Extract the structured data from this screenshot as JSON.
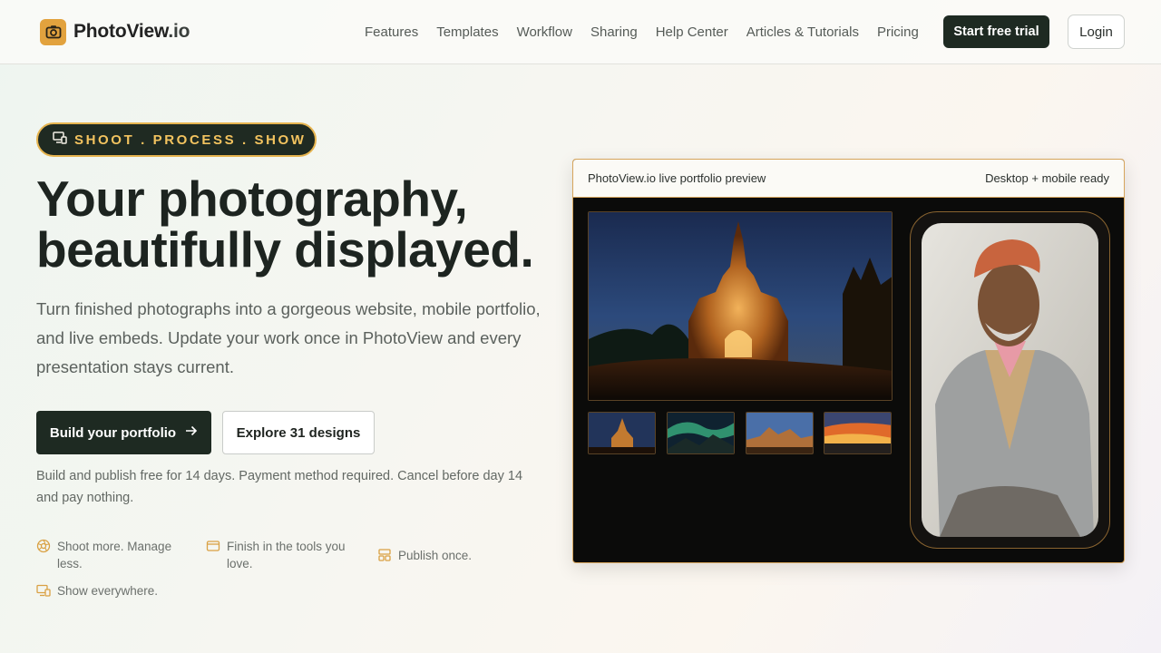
{
  "brand": {
    "name": "PhotoView",
    "tld": ".io",
    "accent": "#e2a23e",
    "dark": "#1e2a22"
  },
  "nav": {
    "links": [
      "Features",
      "Templates",
      "Workflow",
      "Sharing",
      "Help Center",
      "Articles & Tutorials",
      "Pricing"
    ],
    "trial_label": "Start free trial",
    "login_label": "Login"
  },
  "hero": {
    "badge": "SHOOT . PROCESS . SHOW",
    "headline_line1": "Your photography,",
    "headline_line2": "beautifully displayed.",
    "subtitle": "Turn finished photographs into a gorgeous website, mobile portfolio, and live embeds. Update your work once in PhotoView and every presentation stays current.",
    "primary_cta": "Build your portfolio",
    "secondary_cta": "Explore 31 designs",
    "note": "Build and publish free for 14 days. Payment method required. Cancel before day 14 and pay nothing.",
    "features": [
      {
        "label": "Shoot more. Manage less.",
        "icon": "aperture-icon"
      },
      {
        "label": "Finish in the tools you love.",
        "icon": "window-icon"
      },
      {
        "label": "Publish once.",
        "icon": "layout-icon"
      },
      {
        "label": "Show everywhere.",
        "icon": "devices-icon"
      }
    ]
  },
  "preview": {
    "title": "PhotoView.io live portfolio preview",
    "status": "Desktop + mobile ready",
    "main_photo": "temple-at-night",
    "thumbnails": [
      "temple-thumb",
      "aurora-thumb",
      "canyon-thumb",
      "sunset-thumb"
    ],
    "phone_photo": "portrait-elderly-man"
  }
}
